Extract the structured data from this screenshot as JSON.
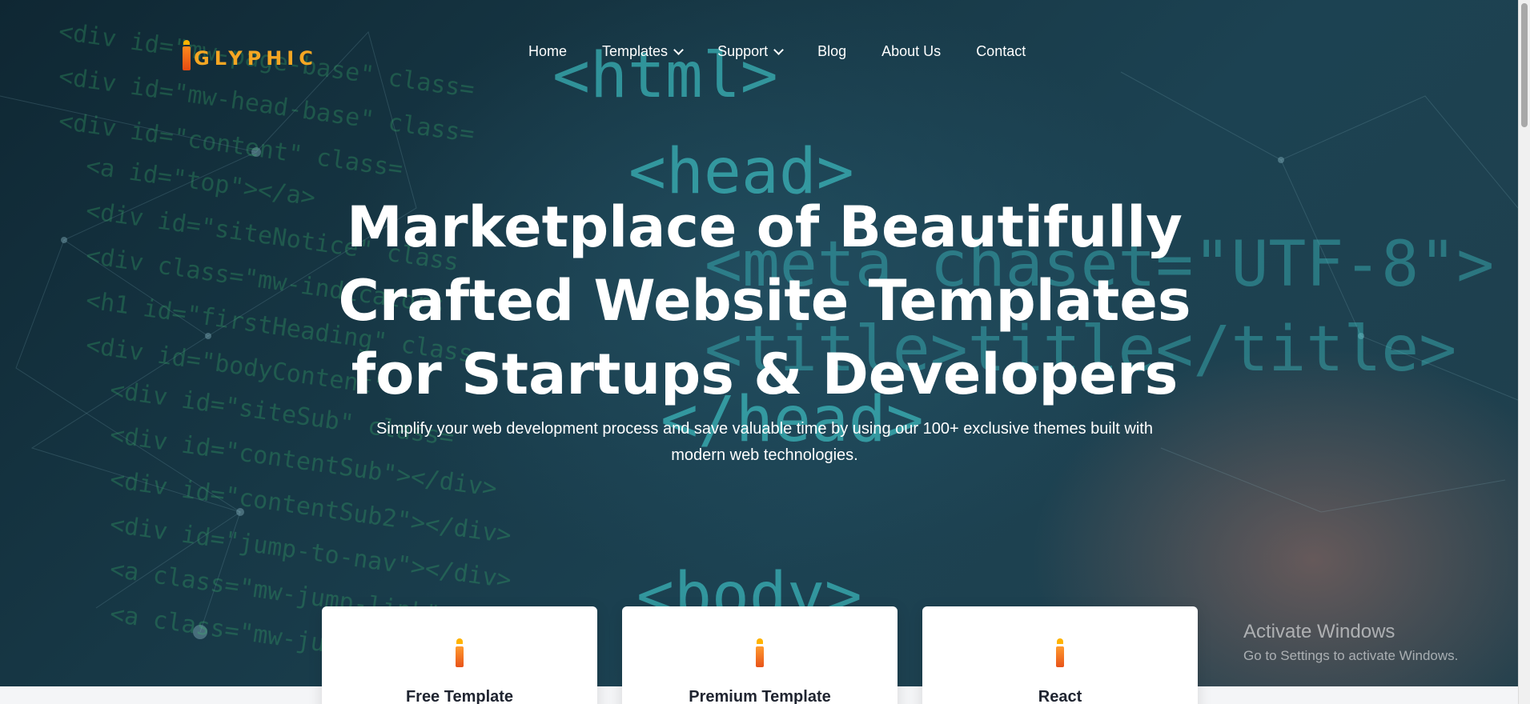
{
  "brand": {
    "logo_text": "GLYPHIC",
    "logo_icon": "flame-i-logo-icon",
    "accent": "#f5a623"
  },
  "nav": {
    "items": [
      {
        "label": "Home"
      },
      {
        "label": "Templates"
      },
      {
        "label": "Support"
      },
      {
        "label": "Blog"
      },
      {
        "label": "About Us"
      },
      {
        "label": "Contact"
      }
    ]
  },
  "hero": {
    "title_line1": "Marketplace of Beautifully",
    "title_line2": "Crafted Website Templates",
    "title_line3": "for Startups & Developers",
    "subtitle_line1": "Simplify your web development process and save valuable time by using our 100+ exclusive themes built with",
    "subtitle_line2": "modern web technologies."
  },
  "background_code": {
    "lines": [
      "<div id=\"mw-page-base\" class=",
      "<div id=\"mw-head-base\" class=",
      "<div id=\"content\" class=",
      "<a id=\"top\"></a>",
      "<div id=\"siteNotice\" class",
      "<div class=\"mw-indicators",
      "<h1 id=\"firstHeading\" class=",
      "<div id=\"bodyContent\"",
      "<div id=\"siteSub\" class=",
      "<div id=\"contentSub\"></div>",
      "<div id=\"contentSub2\"></div>",
      "<div id=\"jump-to-nav\"></div>",
      "<a class=\"mw-jump-link\" href",
      "<a class=\"mw-jump-link\" href"
    ],
    "tags": [
      "<html>",
      "<head>",
      "<meta chaset=\"UTF-8\">",
      "<title>title</title>",
      "</head>",
      "<body>"
    ]
  },
  "cards": [
    {
      "title": "Free Template",
      "icon": "flame-i-icon"
    },
    {
      "title": "Premium Template",
      "icon": "flame-i-icon"
    },
    {
      "title": "React",
      "icon": "flame-i-icon"
    }
  ],
  "watermark": {
    "line1": "Activate Windows",
    "line2": "Go to Settings to activate Windows."
  }
}
